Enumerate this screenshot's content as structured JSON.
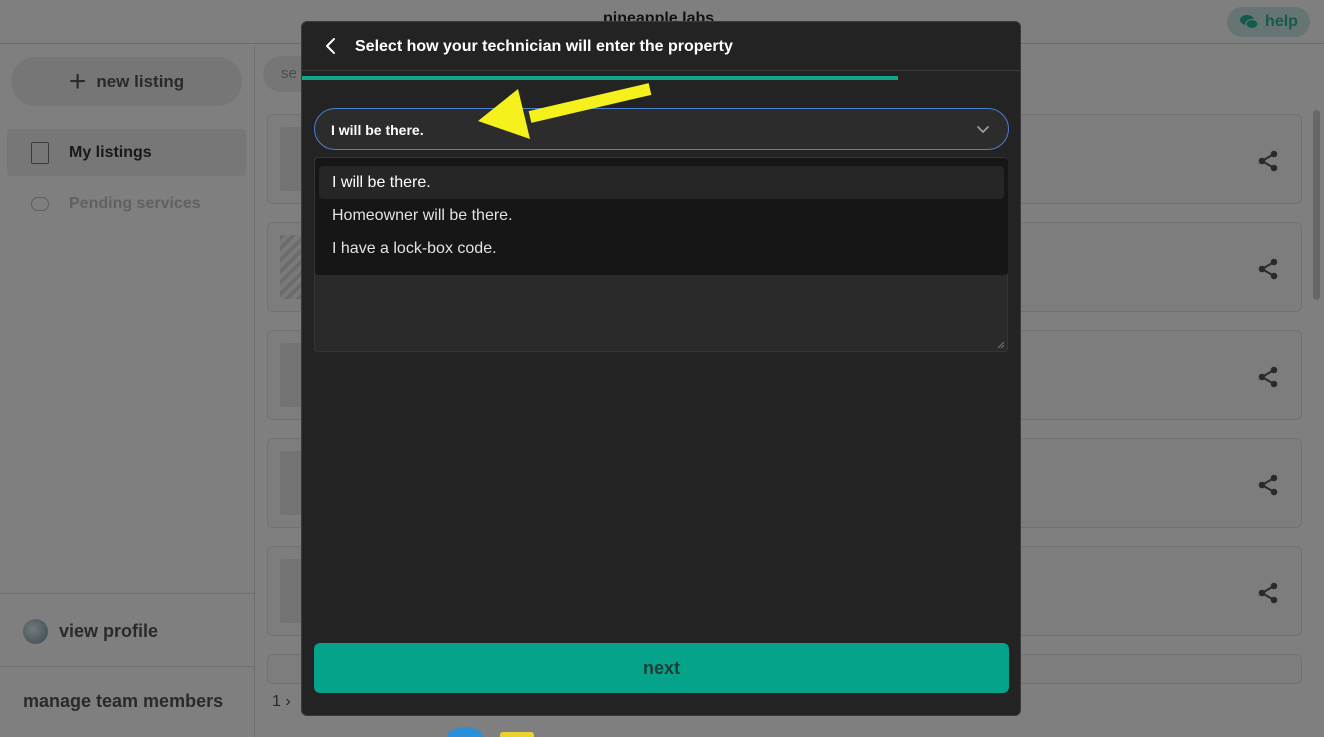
{
  "app": {
    "brand": "pineapple labs",
    "help_label": "help",
    "sidebar": {
      "new_listing_label": "new listing",
      "items": [
        {
          "label": "My listings",
          "active": true
        },
        {
          "label": "Pending services",
          "active": false
        }
      ],
      "view_profile_label": "view profile",
      "manage_team_label": "manage team members"
    },
    "search_placeholder": "se",
    "pager": {
      "current_page": "1"
    },
    "listing_cards": 5
  },
  "modal": {
    "title": "Select how your technician will enter the property",
    "progress_fraction": 0.83,
    "select": {
      "value": "I will be there.",
      "options": [
        {
          "label": "I will be there.",
          "selected": true
        },
        {
          "label": "Homeowner will be there.",
          "selected": false
        },
        {
          "label": "I have a lock-box code.",
          "selected": false
        }
      ]
    },
    "next_label": "next"
  },
  "colors": {
    "accent": "#05a38a",
    "annotation_arrow": "#f5f11c",
    "focus_border": "#4a7fd1"
  },
  "icons": {
    "back": "chevron-left-icon",
    "dropdown": "chevron-down-icon",
    "share": "share-icon",
    "help": "chat-bubbles-icon"
  }
}
